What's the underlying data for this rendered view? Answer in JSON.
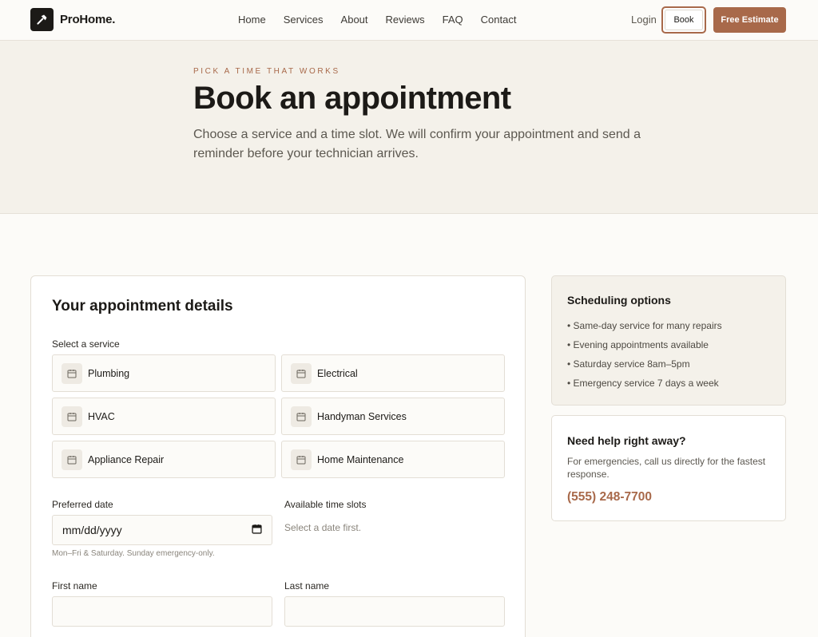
{
  "brand": {
    "name": "ProHome."
  },
  "nav": {
    "links": [
      "Home",
      "Services",
      "About",
      "Reviews",
      "FAQ",
      "Contact"
    ],
    "login": "Login",
    "book": "Book",
    "estimate": "Free Estimate"
  },
  "hero": {
    "eyebrow": "PICK A TIME THAT WORKS",
    "title": "Book an appointment",
    "subtitle": "Choose a service and a time slot. We will confirm your appointment and send a reminder before your technician arrives."
  },
  "form": {
    "title": "Your appointment details",
    "service_label": "Select a service",
    "services": [
      "Plumbing",
      "Electrical",
      "HVAC",
      "Handyman Services",
      "Appliance Repair",
      "Home Maintenance"
    ],
    "date_label": "Preferred date",
    "date_placeholder": "mm/dd/yyyy",
    "date_hint": "Mon–Fri & Saturday. Sunday emergency-only.",
    "slots_label": "Available time slots",
    "slots_empty": "Select a date first.",
    "first_name_label": "First name",
    "last_name_label": "Last name"
  },
  "scheduling": {
    "title": "Scheduling options",
    "items": [
      "• Same-day service for many repairs",
      "• Evening appointments available",
      "• Saturday service 8am–5pm",
      "• Emergency service 7 days a week"
    ]
  },
  "help": {
    "title": "Need help right away?",
    "text": "For emergencies, call us directly for the fastest response.",
    "phone": "(555) 248-7700"
  },
  "colors": {
    "accent": "#a8694a",
    "hero_bg": "#f4f1ea",
    "page_bg": "#fcfbf8"
  },
  "icons": {
    "logo": "hammer-icon",
    "service": "calendar-icon",
    "date": "calendar-icon"
  }
}
